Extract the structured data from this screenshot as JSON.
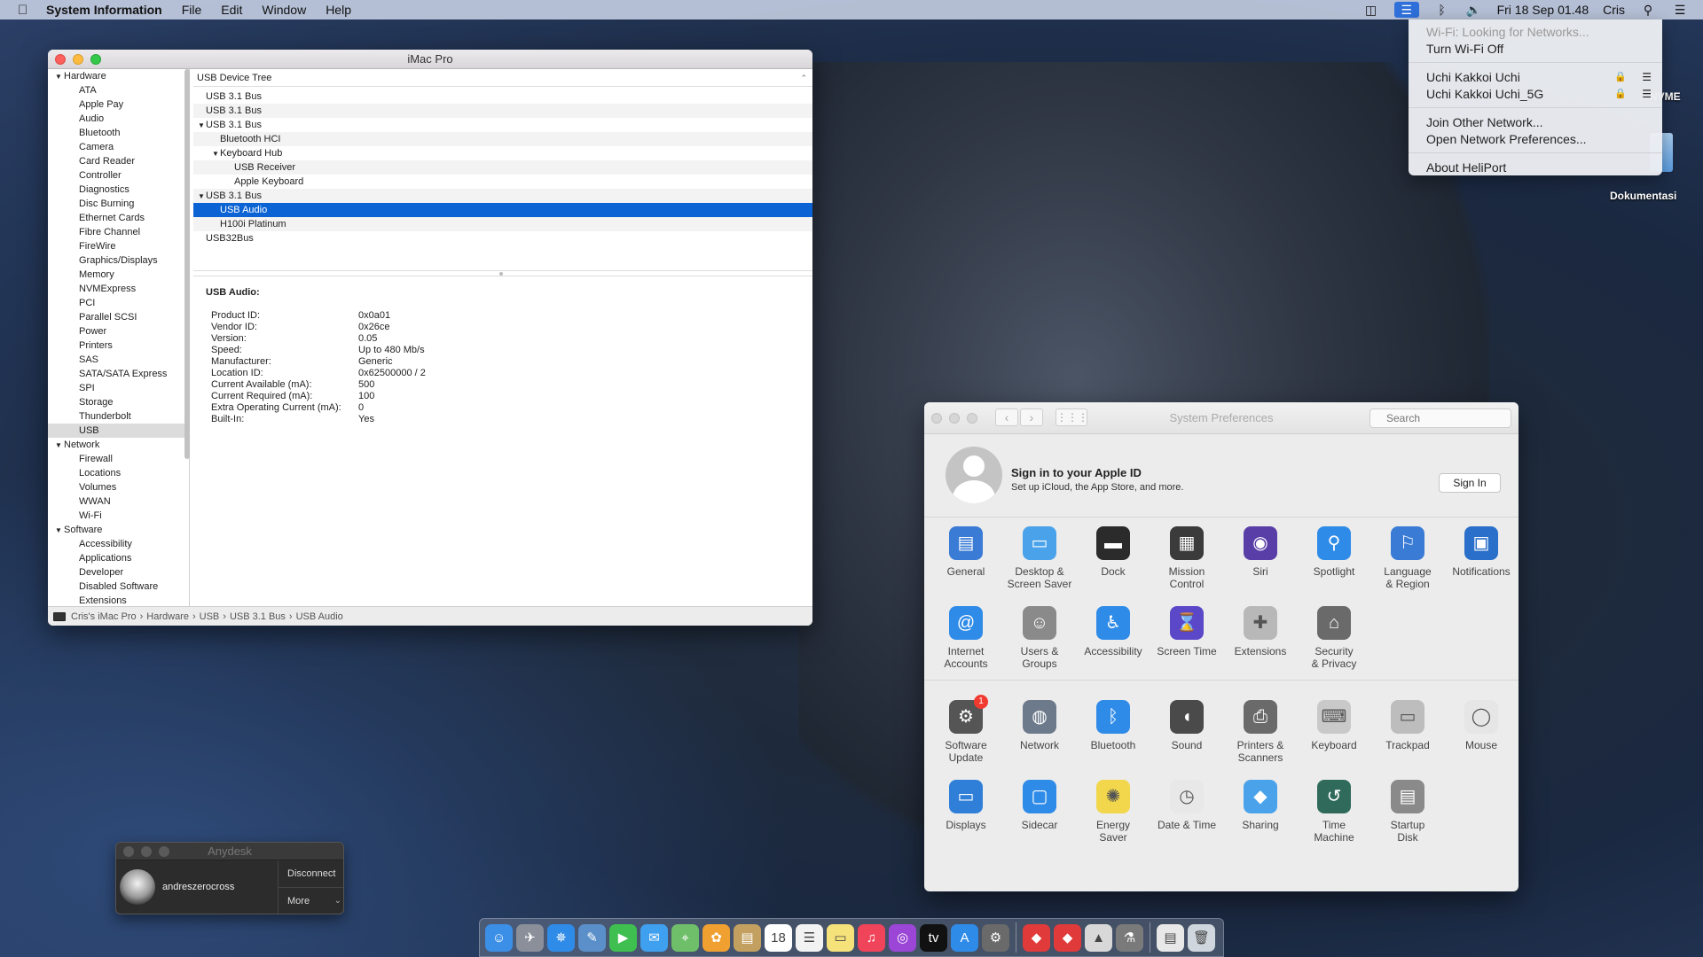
{
  "menubar": {
    "app_name": "System Information",
    "menus": [
      "File",
      "Edit",
      "Window",
      "Help"
    ],
    "clock": "Fri 18 Sep  01.48",
    "user": "Cris"
  },
  "wifi_menu": {
    "status": "Wi-Fi: Looking for Networks...",
    "toggle": "Turn Wi-Fi Off",
    "networks": [
      "Uchi Kakkoi Uchi",
      "Uchi Kakkoi Uchi_5G"
    ],
    "join_other": "Join Other Network...",
    "open_prefs": "Open Network Preferences...",
    "about": "About HeliPort"
  },
  "desktop": {
    "drive_label": "NVME",
    "folder_label": "Dokumentasi"
  },
  "sysinfo": {
    "title": "iMac Pro",
    "sidebar": {
      "hardware": {
        "label": "Hardware",
        "items": [
          "ATA",
          "Apple Pay",
          "Audio",
          "Bluetooth",
          "Camera",
          "Card Reader",
          "Controller",
          "Diagnostics",
          "Disc Burning",
          "Ethernet Cards",
          "Fibre Channel",
          "FireWire",
          "Graphics/Displays",
          "Memory",
          "NVMExpress",
          "PCI",
          "Parallel SCSI",
          "Power",
          "Printers",
          "SAS",
          "SATA/SATA Express",
          "SPI",
          "Storage",
          "Thunderbolt",
          "USB"
        ]
      },
      "network": {
        "label": "Network",
        "items": [
          "Firewall",
          "Locations",
          "Volumes",
          "WWAN",
          "Wi-Fi"
        ]
      },
      "software": {
        "label": "Software",
        "items": [
          "Accessibility",
          "Applications",
          "Developer",
          "Disabled Software",
          "Extensions"
        ]
      }
    },
    "tree_header": "USB Device Tree",
    "tree": [
      {
        "label": "USB 3.1 Bus",
        "indent": 0,
        "expander": ""
      },
      {
        "label": "USB 3.1 Bus",
        "indent": 0,
        "expander": ""
      },
      {
        "label": "USB 3.1 Bus",
        "indent": 0,
        "expander": "▼"
      },
      {
        "label": "Bluetooth HCI",
        "indent": 1,
        "expander": ""
      },
      {
        "label": "Keyboard Hub",
        "indent": 1,
        "expander": "▼"
      },
      {
        "label": "USB Receiver",
        "indent": 2,
        "expander": ""
      },
      {
        "label": "Apple Keyboard",
        "indent": 2,
        "expander": ""
      },
      {
        "label": "USB 3.1 Bus",
        "indent": 0,
        "expander": "▼"
      },
      {
        "label": "USB Audio",
        "indent": 1,
        "expander": "",
        "selected": true
      },
      {
        "label": "H100i Platinum",
        "indent": 1,
        "expander": ""
      },
      {
        "label": "USB32Bus",
        "indent": 0,
        "expander": ""
      }
    ],
    "detail_title": "USB Audio:",
    "details": [
      {
        "k": "Product ID:",
        "v": "0x0a01"
      },
      {
        "k": "Vendor ID:",
        "v": "0x26ce"
      },
      {
        "k": "Version:",
        "v": "0.05"
      },
      {
        "k": "Speed:",
        "v": "Up to 480 Mb/s"
      },
      {
        "k": "Manufacturer:",
        "v": "Generic"
      },
      {
        "k": "Location ID:",
        "v": "0x62500000 / 2"
      },
      {
        "k": "Current Available (mA):",
        "v": "500"
      },
      {
        "k": "Current Required (mA):",
        "v": "100"
      },
      {
        "k": "Extra Operating Current (mA):",
        "v": "0"
      },
      {
        "k": "Built-In:",
        "v": "Yes"
      }
    ],
    "path": [
      "Cris's iMac Pro",
      "Hardware",
      "USB",
      "USB 3.1 Bus",
      "USB Audio"
    ]
  },
  "sysprefs": {
    "title": "System Preferences",
    "search_placeholder": "Search",
    "apple_id_title": "Sign in to your Apple ID",
    "apple_id_sub": "Set up iCloud, the App Store, and more.",
    "sign_in": "Sign In",
    "panes_row1": [
      {
        "l1": "General",
        "l2": "",
        "color": "#3a7bd5",
        "glyph": "▤"
      },
      {
        "l1": "Desktop &",
        "l2": "Screen Saver",
        "color": "#4aa3ea",
        "glyph": "▭"
      },
      {
        "l1": "Dock",
        "l2": "",
        "color": "#2b2b2b",
        "glyph": "▬"
      },
      {
        "l1": "Mission",
        "l2": "Control",
        "color": "#3b3b3b",
        "glyph": "▦"
      },
      {
        "l1": "Siri",
        "l2": "",
        "color": "#5a3ea8",
        "glyph": "◉"
      },
      {
        "l1": "Spotlight",
        "l2": "",
        "color": "#2f8be8",
        "glyph": "⚲"
      },
      {
        "l1": "Language",
        "l2": "& Region",
        "color": "#3a7bd5",
        "glyph": "⚐"
      },
      {
        "l1": "Notifications",
        "l2": "",
        "color": "#2a6fc9",
        "glyph": "▣"
      }
    ],
    "panes_row2": [
      {
        "l1": "Internet",
        "l2": "Accounts",
        "color": "#2f8be8",
        "glyph": "@"
      },
      {
        "l1": "Users &",
        "l2": "Groups",
        "color": "#8a8a8a",
        "glyph": "☺"
      },
      {
        "l1": "Accessibility",
        "l2": "",
        "color": "#2f8be8",
        "glyph": "♿"
      },
      {
        "l1": "Screen Time",
        "l2": "",
        "color": "#5b48c9",
        "glyph": "⌛"
      },
      {
        "l1": "Extensions",
        "l2": "",
        "color": "#b8b8b8",
        "glyph": "✚"
      },
      {
        "l1": "Security",
        "l2": "& Privacy",
        "color": "#6a6a6a",
        "glyph": "⌂"
      }
    ],
    "panes_row3": [
      {
        "l1": "Software",
        "l2": "Update",
        "color": "#555555",
        "glyph": "⚙",
        "badge": "1"
      },
      {
        "l1": "Network",
        "l2": "",
        "color": "#6d7a8c",
        "glyph": "◍"
      },
      {
        "l1": "Bluetooth",
        "l2": "",
        "color": "#2f8be8",
        "glyph": "ᛒ"
      },
      {
        "l1": "Sound",
        "l2": "",
        "color": "#4a4a4a",
        "glyph": "◖"
      },
      {
        "l1": "Printers &",
        "l2": "Scanners",
        "color": "#6a6a6a",
        "glyph": "⎙"
      },
      {
        "l1": "Keyboard",
        "l2": "",
        "color": "#c9c9c9",
        "glyph": "⌨"
      },
      {
        "l1": "Trackpad",
        "l2": "",
        "color": "#bdbdbd",
        "glyph": "▭"
      },
      {
        "l1": "Mouse",
        "l2": "",
        "color": "#e6e6e6",
        "glyph": "◯"
      }
    ],
    "panes_row4": [
      {
        "l1": "Displays",
        "l2": "",
        "color": "#2f7fd9",
        "glyph": "▭"
      },
      {
        "l1": "Sidecar",
        "l2": "",
        "color": "#2f8be8",
        "glyph": "▢"
      },
      {
        "l1": "Energy",
        "l2": "Saver",
        "color": "#f2d64b",
        "glyph": "✺"
      },
      {
        "l1": "Date & Time",
        "l2": "",
        "color": "#e8e8e8",
        "glyph": "◷"
      },
      {
        "l1": "Sharing",
        "l2": "",
        "color": "#4aa3ea",
        "glyph": "◆"
      },
      {
        "l1": "Time",
        "l2": "Machine",
        "color": "#2f6a5a",
        "glyph": "↺"
      },
      {
        "l1": "Startup",
        "l2": "Disk",
        "color": "#8a8a8a",
        "glyph": "▤"
      }
    ]
  },
  "anydesk": {
    "title": "Anydesk",
    "user": "andreszerocross",
    "disconnect": "Disconnect",
    "more": "More"
  },
  "dock": [
    {
      "name": "finder",
      "color": "#3c8fe6",
      "glyph": "☺"
    },
    {
      "name": "launchpad",
      "color": "#8a8f9a",
      "glyph": "✈"
    },
    {
      "name": "safari",
      "color": "#2f8be8",
      "glyph": "✵"
    },
    {
      "name": "preview",
      "color": "#5a8fc9",
      "glyph": "✎"
    },
    {
      "name": "facetime",
      "color": "#3fbf4f",
      "glyph": "▶"
    },
    {
      "name": "messages",
      "color": "#3fa0ef",
      "glyph": "✉"
    },
    {
      "name": "maps",
      "color": "#6fbf6a",
      "glyph": "⌖"
    },
    {
      "name": "photos",
      "color": "#f0a030",
      "glyph": "✿"
    },
    {
      "name": "notes-app",
      "color": "#c4a060",
      "glyph": "▤"
    },
    {
      "name": "calendar",
      "color": "#ffffff",
      "glyph": "18"
    },
    {
      "name": "reminders",
      "color": "#f2f2f2",
      "glyph": "☰"
    },
    {
      "name": "notes",
      "color": "#f6e27a",
      "glyph": "▭"
    },
    {
      "name": "music",
      "color": "#f0445a",
      "glyph": "♫"
    },
    {
      "name": "podcasts",
      "color": "#9b46d6",
      "glyph": "◎"
    },
    {
      "name": "tv",
      "color": "#111111",
      "glyph": "tv"
    },
    {
      "name": "app-store",
      "color": "#2f8be8",
      "glyph": "A"
    },
    {
      "name": "system-preferences",
      "color": "#6a6a6a",
      "glyph": "⚙"
    },
    {
      "name": "anydesk",
      "color": "#e03a3a",
      "glyph": "◆"
    },
    {
      "name": "anydesk-2",
      "color": "#e03a3a",
      "glyph": "◆"
    },
    {
      "name": "preview-2",
      "color": "#d8d8d8",
      "glyph": "▲"
    },
    {
      "name": "system-information",
      "color": "#7a7a7a",
      "glyph": "⚗"
    },
    {
      "name": "documents",
      "color": "#e8e8e8",
      "glyph": "▤"
    },
    {
      "name": "trash",
      "color": "#cfd6dd",
      "glyph": "🗑"
    }
  ]
}
